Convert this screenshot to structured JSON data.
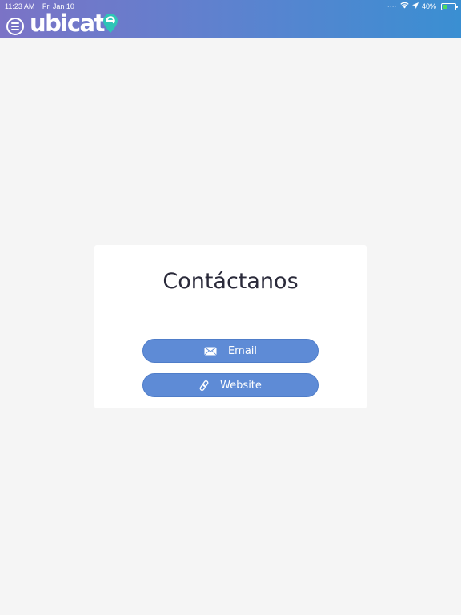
{
  "status_bar": {
    "time": "11:23 AM",
    "date": "Fri Jan 10",
    "battery": "40%",
    "battery_level": 0.4
  },
  "header": {
    "logo_text": "ubicat",
    "menu_icon": "menu-icon",
    "logo_pin_icon": "location-pin-icon",
    "gradient_start": "#7b73c6",
    "gradient_end": "#3a8fd2",
    "pin_color": "#2ec4b6"
  },
  "card": {
    "title": "Contáctanos",
    "buttons": [
      {
        "label": "Email",
        "icon": "envelope-icon"
      },
      {
        "label": "Website",
        "icon": "link-icon"
      }
    ],
    "button_color": "#5e8bd6"
  }
}
